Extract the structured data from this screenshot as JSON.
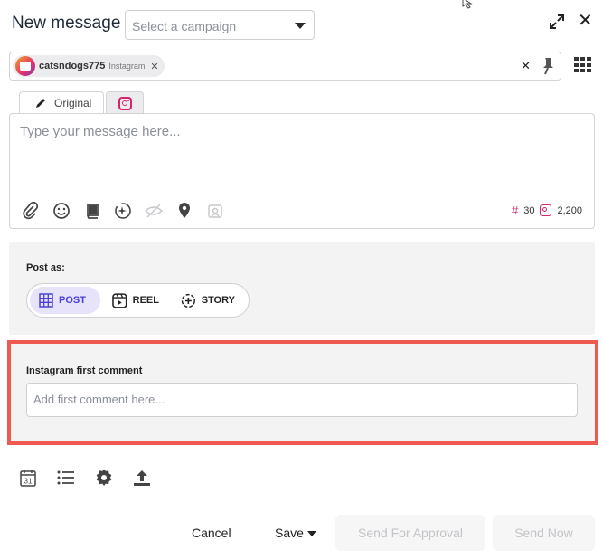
{
  "header": {
    "title": "New message",
    "campaign_placeholder": "Select a campaign"
  },
  "recipients": {
    "chips": [
      {
        "name": "catsndogs775",
        "network": "Instagram"
      }
    ]
  },
  "composer": {
    "tabs": [
      {
        "label": "Original",
        "icon": "pencil-icon"
      },
      {
        "label": "",
        "icon": "instagram-icon"
      }
    ],
    "placeholder": "Type your message here...",
    "hashtag_count": "30",
    "char_limit": "2,200",
    "tools": [
      "paperclip-icon",
      "emoji-icon",
      "library-icon",
      "ai-assist-icon",
      "hide-icon",
      "location-icon",
      "media-tag-icon"
    ]
  },
  "post_as": {
    "label": "Post as:",
    "options": [
      {
        "label": "POST",
        "icon": "grid-icon",
        "active": true
      },
      {
        "label": "REEL",
        "icon": "reel-icon",
        "active": false
      },
      {
        "label": "STORY",
        "icon": "story-icon",
        "active": false
      }
    ]
  },
  "first_comment": {
    "label": "Instagram first comment",
    "placeholder": "Add first comment here..."
  },
  "footer": {
    "cancel": "Cancel",
    "save": "Save",
    "send_for_approval": "Send For Approval",
    "send_now": "Send Now",
    "calendar_day": "31"
  },
  "colors": {
    "accent": "#4b3fd6",
    "accent_bg": "#e6e3fb",
    "instagram": "#d6246e",
    "highlight_border": "#ee5a4f",
    "panel_bg": "#f3f3f4"
  }
}
